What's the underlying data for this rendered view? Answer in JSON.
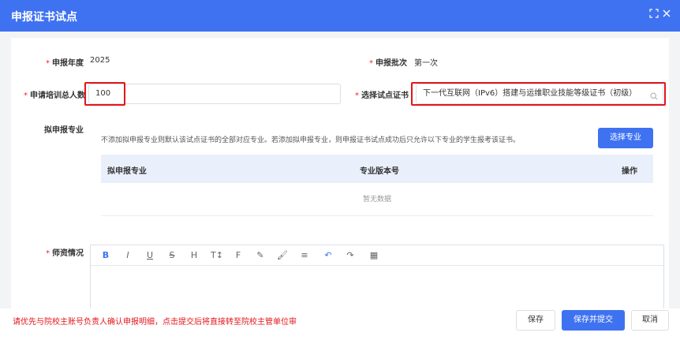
{
  "dialog": {
    "title": "申报证书试点",
    "icons": {
      "maximize": "maximize-icon",
      "close": "close-icon"
    }
  },
  "form": {
    "year": {
      "label": "申报年度",
      "value": "2025"
    },
    "batch": {
      "label": "申报批次",
      "value": "第一次"
    },
    "total": {
      "label": "申请培训总人数",
      "value": "100"
    },
    "cert": {
      "label": "选择试点证书",
      "value": "下一代互联网（IPv6）搭建与运维职业技能等级证书（初级）"
    },
    "major": {
      "label": "拟申报专业",
      "hint": "不添加拟申报专业则默认该试点证书的全部对应专业。若添加拟申报专业，则申报证书试点成功后只允许以下专业的学生报考该证书。",
      "select_button": "选择专业",
      "columns": [
        "拟申报专业",
        "专业版本号",
        "操作"
      ],
      "empty_text": "暂无数据"
    },
    "teachers": {
      "label": "师资情况"
    }
  },
  "toolbar_icons": [
    "bold-icon",
    "italic-icon",
    "underline-icon",
    "strikethrough-icon",
    "heading-icon",
    "font-size-icon",
    "font-family-icon",
    "highlight-icon",
    "brush-icon",
    "align-icon",
    "undo-icon",
    "redo-icon",
    "table-icon"
  ],
  "toolbar_glyphs": [
    "B",
    "I",
    "U",
    "S",
    "H",
    "T↕",
    "F",
    "✎",
    "🖌",
    "≡",
    "↶",
    "↷",
    "▦"
  ],
  "footer": {
    "warning": "请优先与院校主账号负责人确认申报明细，点击提交后将直接转至院校主管单位审",
    "save": "保存",
    "save_submit": "保存并提交",
    "cancel": "取消"
  },
  "colors": {
    "primary": "#3f72f1",
    "required": "#f5222d",
    "highlight_border": "#e5141b"
  }
}
